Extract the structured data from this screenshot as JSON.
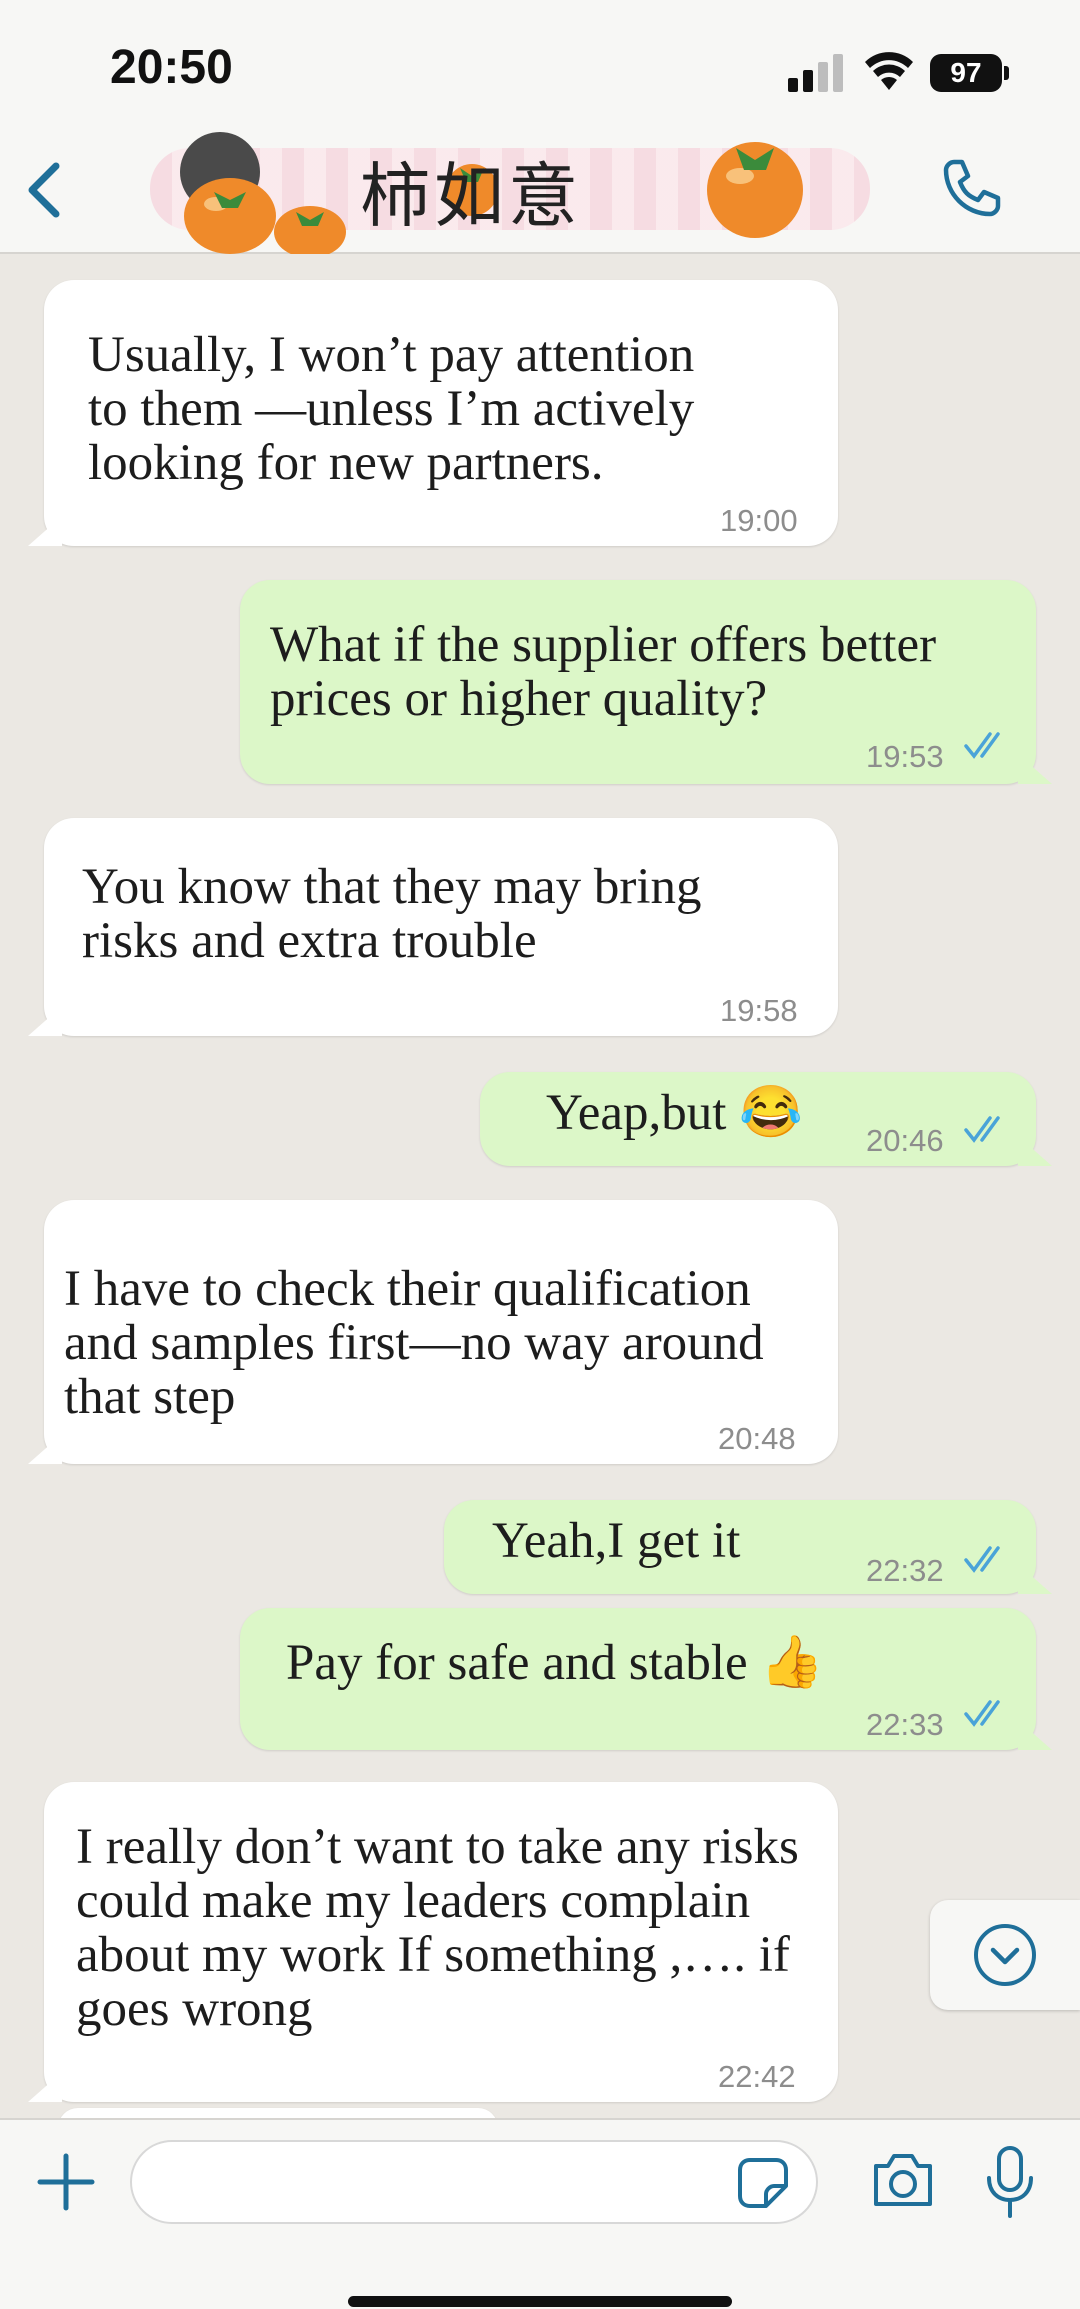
{
  "status_bar": {
    "time": "20:50",
    "battery": "97"
  },
  "header": {
    "chat_title": "柿如意"
  },
  "messages": [
    {
      "direction": "incoming",
      "text": "Usually, I won’t pay attention\n to them —unless I’m actively\n looking for new partners.",
      "time": "19:00"
    },
    {
      "direction": "outgoing",
      "text": "What if the supplier offers better\n prices or higher quality?",
      "time": "19:53",
      "read": true
    },
    {
      "direction": "incoming",
      "text": "You know that they  may bring\n risks and extra trouble",
      "time": "19:58"
    },
    {
      "direction": "outgoing",
      "text": "Yeap,but 😂",
      "time": "20:46",
      "read": true
    },
    {
      "direction": "incoming",
      "text": "I have to check their qualification\nand samples first—no way around\n that step",
      "time": "20:48"
    },
    {
      "direction": "outgoing",
      "text": "Yeah,I get it",
      "time": "22:32",
      "read": true
    },
    {
      "direction": "outgoing",
      "text": "Pay for safe and stable 👍",
      "time": "22:33",
      "read": true
    },
    {
      "direction": "incoming",
      "text": "I really don’t want to take any risks\n could  make my leaders complain\n about my work If something ,…. if\n goes wrong",
      "time": "22:42"
    }
  ],
  "composer": {
    "placeholder": "",
    "value": ""
  },
  "colors": {
    "incoming_bubble": "#ffffff",
    "outgoing_bubble": "#dcf7c8",
    "accent": "#1f6f99",
    "read_ticks": "#4aa3d8",
    "background": "#ebe8e3"
  },
  "icons": [
    "back-chevron-icon",
    "phone-icon",
    "signal-icon",
    "wifi-icon",
    "plus-icon",
    "sticker-icon",
    "camera-icon",
    "microphone-icon",
    "chevron-down-icon"
  ]
}
